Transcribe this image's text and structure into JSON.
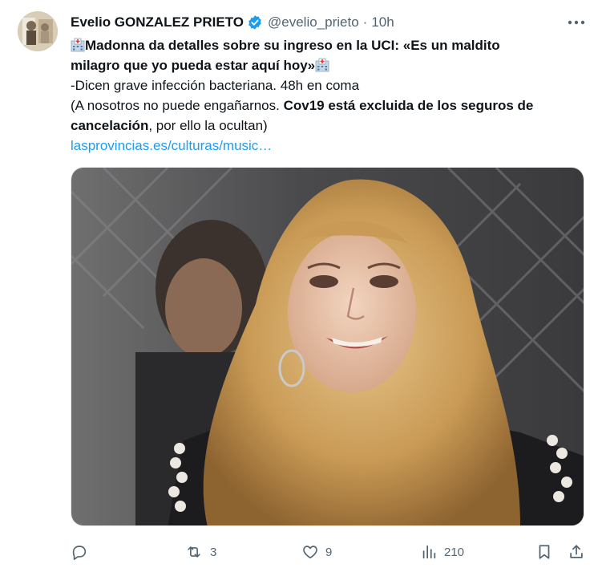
{
  "author": {
    "name": "Evelio GONZALEZ PRIETO",
    "handle": "@evelio_prieto",
    "separator": "·",
    "time": "10h",
    "verified": true
  },
  "tweet": {
    "title_line1": "Madonna da detalles sobre su ingreso en la UCI: «Es un maldito",
    "title_line2": "milagro que yo pueda estar aquí hoy»",
    "line3": "-Dicen grave infección bacteriana. 48h en coma",
    "line4_normal": "(A nosotros no puede engañarnos. ",
    "line4_bold": "Cov19 está excluida de los seguros de",
    "line5_bold": "cancelación",
    "line5_normal": ", por ello la ocultan)",
    "link": "lasprovincias.es/culturas/music…"
  },
  "actions": {
    "reply_count": "",
    "retweet_count": "3",
    "like_count": "9",
    "view_count": "210"
  },
  "icons": {
    "avatar": "avatar-photo",
    "verified": "verified-badge-icon",
    "more": "more-options-icon",
    "hospital": "hospital-emoji-icon",
    "reply": "reply-icon",
    "retweet": "retweet-icon",
    "like": "heart-icon",
    "views": "views-chart-icon",
    "bookmark": "bookmark-icon",
    "share": "share-icon"
  },
  "colors": {
    "link": "#1d9bf0",
    "verified": "#1d9bf0",
    "secondary_text": "#536471"
  }
}
